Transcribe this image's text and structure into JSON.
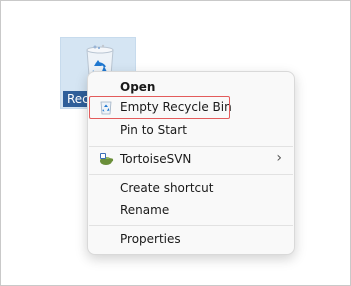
{
  "desktop": {
    "icon_label": "Rec"
  },
  "context_menu": {
    "items": [
      {
        "label": "Open"
      },
      {
        "label": "Empty Recycle Bin"
      },
      {
        "label": "Pin to Start"
      },
      {
        "label": "TortoiseSVN"
      },
      {
        "label": "Create shortcut"
      },
      {
        "label": "Rename"
      },
      {
        "label": "Properties"
      }
    ],
    "submenu_chevron": "›"
  },
  "colors": {
    "highlight_border": "#e35b5b",
    "menu_background": "#f9f9f9",
    "icon_selection": "#d5e5f3"
  },
  "icons": {
    "recycle_bin": "recycle-bin-icon",
    "tortoisesvn": "tortoisesvn-icon"
  }
}
